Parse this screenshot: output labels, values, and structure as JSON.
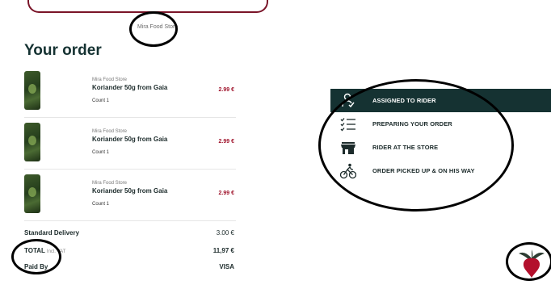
{
  "store_caption": "Mira Food Store",
  "order": {
    "title": "Your order",
    "items": [
      {
        "store": "Mira Food Store",
        "name": "Koriander 50g from Gaia",
        "count": "Count 1",
        "price": "2.99 €"
      },
      {
        "store": "Mira Food Store",
        "name": "Koriander 50g from Gaia",
        "count": "Count 1",
        "price": "2.99 €"
      },
      {
        "store": "Mira Food Store",
        "name": "Koriander 50g from Gaia",
        "count": "Count 1",
        "price": "2.99 €"
      }
    ],
    "delivery_label": "Standard Delivery",
    "delivery_value": "3.00 €",
    "total_label": "TOTAL",
    "total_sub": "Incl. VAT",
    "total_value": "11,97 €",
    "paid_by_label": "Paid By",
    "paid_by_value": "VISA"
  },
  "status_steps": [
    {
      "label": "ASSIGNED TO RIDER",
      "icon": "assigned-rider-icon",
      "active": true
    },
    {
      "label": "PREPARING YOUR ORDER",
      "icon": "checklist-icon",
      "active": false
    },
    {
      "label": "RIDER AT THE STORE",
      "icon": "store-icon",
      "active": false
    },
    {
      "label": "ORDER PICKED UP & ON HIS WAY",
      "icon": "bike-rider-icon",
      "active": false
    }
  ],
  "colors": {
    "brand_dark": "#153232",
    "price_red": "#a0142c",
    "logo_red": "#b3102c"
  },
  "logo_icon": "beetroot-logo-icon"
}
